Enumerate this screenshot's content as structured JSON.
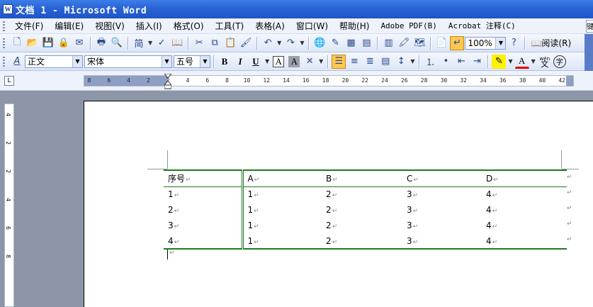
{
  "window": {
    "icon_letter": "W",
    "title": "文档 1 - Microsoft Word"
  },
  "menu": [
    {
      "label": "文件(F)"
    },
    {
      "label": "编辑(E)"
    },
    {
      "label": "视图(V)"
    },
    {
      "label": "插入(I)"
    },
    {
      "label": "格式(O)"
    },
    {
      "label": "工具(T)"
    },
    {
      "label": "表格(A)"
    },
    {
      "label": "窗口(W)"
    },
    {
      "label": "帮助(H)"
    },
    {
      "label": "Adobe PDF(B)"
    },
    {
      "label": "Acrobat 注释(C)"
    }
  ],
  "search_stub": "键",
  "toolbar": {
    "jian_label": "简",
    "zoom": "100%",
    "read_label": "阅读(R)"
  },
  "format": {
    "style": "正文",
    "font": "宋体",
    "size": "五号",
    "style_icon": "A",
    "bold": "B",
    "italic": "I",
    "underline": "U",
    "char_border": "A",
    "char_shade": "A",
    "font_color_A": "A",
    "wen": "文",
    "phonetic": "wén",
    "circle": "字"
  },
  "ruler": {
    "tab_selector": "L",
    "h_ticks": [
      "8",
      "6",
      "4",
      "2",
      "2",
      "4",
      "6",
      "8",
      "10",
      "12",
      "14",
      "16",
      "18",
      "20",
      "22",
      "24",
      "26",
      "28",
      "30",
      "32",
      "34",
      "36",
      "38",
      "40",
      "42"
    ],
    "v_ticks": [
      "4",
      "2",
      "2",
      "4",
      "6",
      "8"
    ]
  },
  "table": {
    "header": [
      "序号",
      "A",
      "B",
      "C",
      "D"
    ],
    "rows": [
      [
        "1",
        "1",
        "2",
        "3",
        "4"
      ],
      [
        "2",
        "1",
        "2",
        "3",
        "4"
      ],
      [
        "3",
        "1",
        "2",
        "3",
        "4"
      ],
      [
        "4",
        "1",
        "2",
        "3",
        "4"
      ]
    ]
  },
  "para_mark": "↵",
  "colors": {
    "title_bar": "#2a63d4",
    "table_border": "#1e7a1e",
    "workspace": "#8c96a8"
  }
}
